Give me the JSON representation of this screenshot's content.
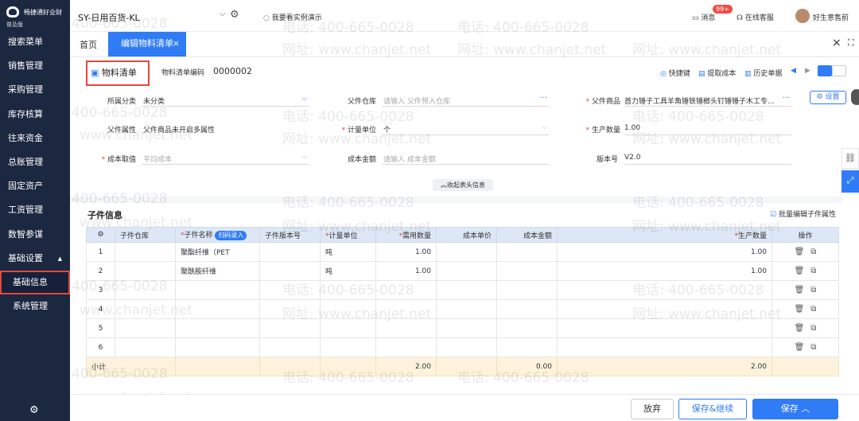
{
  "sidebar": {
    "brand": "畅捷通好业财",
    "edition": "普及版",
    "items": [
      {
        "label": "搜索菜单"
      },
      {
        "label": "销售管理"
      },
      {
        "label": "采购管理"
      },
      {
        "label": "库存核算"
      },
      {
        "label": "往来资金"
      },
      {
        "label": "总账管理"
      },
      {
        "label": "固定资产"
      },
      {
        "label": "工资管理"
      },
      {
        "label": "数智参谋"
      },
      {
        "label": "基础设置"
      },
      {
        "label": "基础信息"
      },
      {
        "label": "系统管理"
      }
    ]
  },
  "topbar": {
    "account": "SY-日用百货-KL",
    "demo": "我要看实例演示",
    "messages": "消息",
    "badge": "99+",
    "service": "在线客服",
    "user": "好生意售前"
  },
  "tabs": {
    "home": "首页",
    "active": "编辑物料清单",
    "close": "×"
  },
  "header": {
    "title": "物料清单",
    "code_label": "物料清单编码",
    "code": "0000002",
    "shortcut": "快捷键",
    "fetch_cost": "提取成本",
    "history": "历史单据"
  },
  "form": {
    "category_label": "所属分类",
    "category": "未分类",
    "warehouse_label": "父件仓库",
    "warehouse_ph": "请输入 父件预入仓库",
    "product_label": "父件商品",
    "product": "首力锤子工具羊角锤铁锤榔头钉锤锤子木工专...",
    "attr_label": "父件属性",
    "attr": "父件商品未开启多属性",
    "unit_label": "计量单位",
    "unit": "个",
    "qty_label": "生产数量",
    "qty": "1.00",
    "cost_label": "成本取值",
    "cost_ph": "平均成本",
    "amount_label": "成本金额",
    "amount_ph": "请输入 成本金额",
    "version_label": "版本号",
    "version": "V2.0",
    "settings": "设置",
    "collapse": "收起表头信息"
  },
  "children": {
    "title": "子件信息",
    "batch_edit": "批量编辑子件属性",
    "scan": "扫码录入",
    "columns": [
      "子件仓库",
      "子件名称",
      "子件版本号",
      "计量单位",
      "需用数量",
      "成本单价",
      "成本金额",
      "生产数量",
      "操作"
    ],
    "rows": [
      {
        "no": "1",
        "name": "聚酯纤维（PET",
        "unit": "吨",
        "need": "1.00",
        "prod": "1.00"
      },
      {
        "no": "2",
        "name": "聚酰胺纤维",
        "unit": "吨",
        "need": "1.00",
        "prod": "1.00"
      },
      {
        "no": "3",
        "name": "",
        "unit": "",
        "need": "",
        "prod": ""
      },
      {
        "no": "4",
        "name": "",
        "unit": "",
        "need": "",
        "prod": ""
      },
      {
        "no": "5",
        "name": "",
        "unit": "",
        "need": "",
        "prod": ""
      },
      {
        "no": "6",
        "name": "",
        "unit": "",
        "need": "",
        "prod": ""
      }
    ],
    "subtotal_label": "小计",
    "subtotal_need": "2.00",
    "subtotal_amount": "0.00",
    "subtotal_prod": "2.00"
  },
  "footer": {
    "cancel": "放弃",
    "save_continue": "保存&继续",
    "save": "保存"
  },
  "watermark": {
    "phone": "电话: 400-665-0028",
    "site": "网址: www.chanjet.net",
    "code": "400-665-0028",
    "site_short": "www.chanjet.net"
  },
  "colors": {
    "sidebar": "#1c2740",
    "accent": "#2f7cf6",
    "highlight": "#e0493c",
    "subtotal": "#fdf3dc"
  }
}
